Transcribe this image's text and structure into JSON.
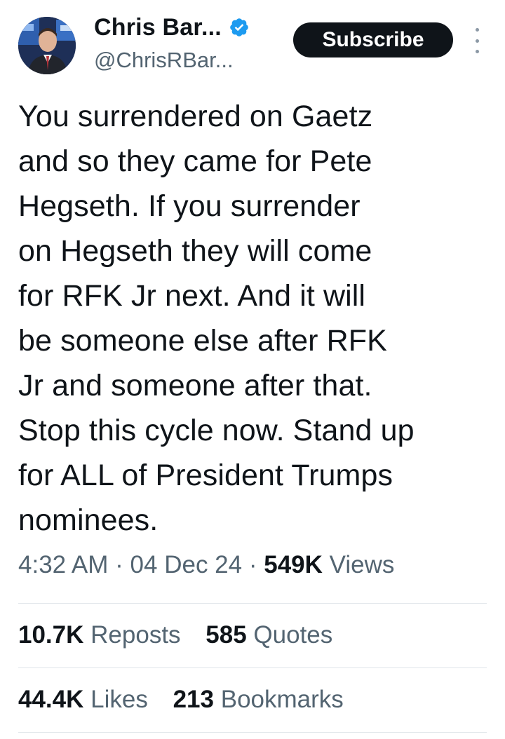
{
  "author": {
    "display_name": "Chris Bar...",
    "handle": "@ChrisRBar...",
    "verified": true
  },
  "header": {
    "subscribe_label": "Subscribe"
  },
  "tweet": {
    "text": "You surrendered on Gaetz\nand so they came for Pete\nHegseth. If you surrender\non Hegseth they will come\nfor RFK Jr next. And it will\nbe someone else after RFK\nJr and someone after that.\nStop this cycle now. Stand up\nfor ALL of President Trumps\nnominees."
  },
  "meta": {
    "time": "4:32 AM",
    "separator": "·",
    "date": "04 Dec 24",
    "views_count": "549K",
    "views_label": "Views"
  },
  "stats": {
    "reposts_count": "10.7K",
    "reposts_label": "Reposts",
    "quotes_count": "585",
    "quotes_label": "Quotes",
    "likes_count": "44.4K",
    "likes_label": "Likes",
    "bookmarks_count": "213",
    "bookmarks_label": "Bookmarks"
  },
  "colors": {
    "text_primary": "#0f1419",
    "text_secondary": "#536471",
    "verified_blue": "#1d9bf0",
    "subscribe_bg": "#0f1419",
    "divider": "#e1e6ea"
  }
}
